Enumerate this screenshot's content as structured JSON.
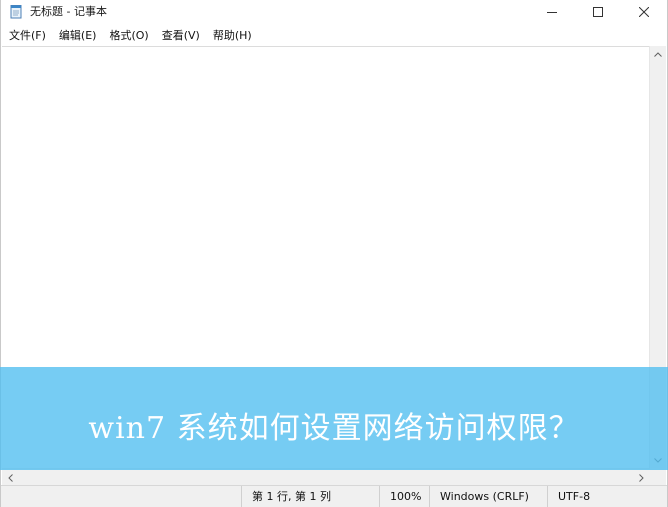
{
  "window": {
    "title": "无标题 - 记事本",
    "icon": "notepad-icon",
    "controls": [
      "minimize-icon",
      "maximize-icon",
      "close-icon"
    ]
  },
  "menu": {
    "items": [
      {
        "label": "文件(F)"
      },
      {
        "label": "编辑(E)"
      },
      {
        "label": "格式(O)"
      },
      {
        "label": "查看(V)"
      },
      {
        "label": "帮助(H)"
      }
    ]
  },
  "editor": {
    "text": ""
  },
  "status": {
    "position": "第 1 行, 第 1 列",
    "zoom": "100%",
    "line_ending": "Windows (CRLF)",
    "encoding": "UTF-8"
  },
  "overlay": {
    "caption": "win7 系统如何设置网络访问权限？",
    "color": "#50bef0"
  }
}
